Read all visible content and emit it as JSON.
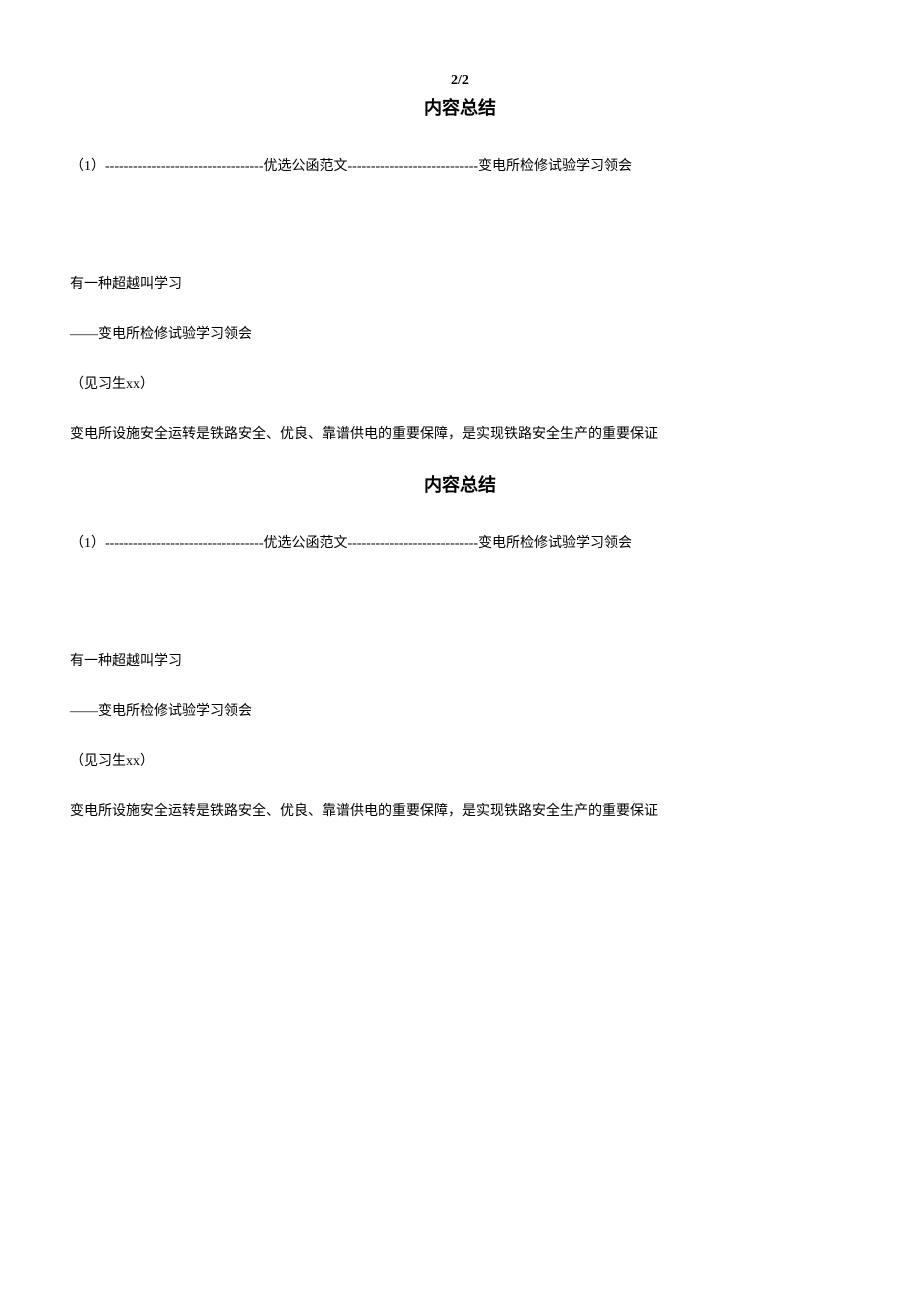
{
  "page_number": "2/2",
  "section1": {
    "title": "内容总结",
    "line1": "（1）----------------------------------优选公函范文----------------------------变电所检修试验学习领会",
    "line2": "有一种超越叫学习",
    "line3": "——变电所检修试验学习领会",
    "line4": "（见习生xx）",
    "line5": "变电所设施安全运转是铁路安全、优良、靠谱供电的重要保障，是实现铁路安全生产的重要保证"
  },
  "section2": {
    "title": "内容总结",
    "line1": "（1）----------------------------------优选公函范文----------------------------变电所检修试验学习领会",
    "line2": "有一种超越叫学习",
    "line3": "——变电所检修试验学习领会",
    "line4": "（见习生xx）",
    "line5": "变电所设施安全运转是铁路安全、优良、靠谱供电的重要保障，是实现铁路安全生产的重要保证"
  }
}
